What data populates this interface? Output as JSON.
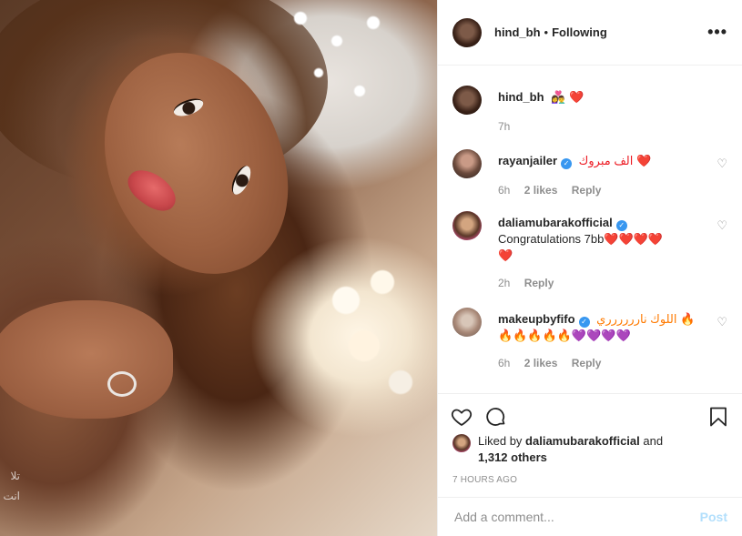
{
  "post": {
    "author": "hind_bh",
    "follow_status": "Following",
    "dot": "•",
    "more": "•••"
  },
  "photo": {
    "overlay_text": "تلا انت"
  },
  "caption": {
    "user": "hind_bh",
    "text": "👩‍❤️‍👨 ❤️",
    "time": "7h"
  },
  "comments": [
    {
      "user": "rayanjailer",
      "verified": true,
      "text": "الف مبروك ❤️",
      "time": "6h",
      "likes": "2 likes",
      "reply": "Reply"
    },
    {
      "user": "daliamubarakofficial",
      "verified": true,
      "text": "Congratulations 7bb❤️❤️❤️❤️",
      "text2": "❤️",
      "time": "2h",
      "reply": "Reply"
    },
    {
      "user": "makeupbyfifo",
      "verified": true,
      "text": "اللوك نارررررري 🔥",
      "text2": "🔥🔥🔥🔥🔥💜💜💜💜",
      "time": "6h",
      "likes": "2 likes",
      "reply": "Reply"
    }
  ],
  "likes": {
    "prefix": "Liked by",
    "user": "daliamubarakofficial",
    "and": "and",
    "others": "1,312 others"
  },
  "timestamp": "7 HOURS AGO",
  "add_comment": {
    "placeholder": "Add a comment...",
    "post_label": "Post"
  },
  "icons": {
    "like": "heart-icon",
    "comment": "comment-icon",
    "save": "bookmark-icon",
    "verified": "verified-badge-icon"
  },
  "colors": {
    "link_blue": "#3897f0",
    "post_disabled": "#b2dffc",
    "meta_gray": "#8e8e8e",
    "heart_red": "#ed1c24"
  }
}
